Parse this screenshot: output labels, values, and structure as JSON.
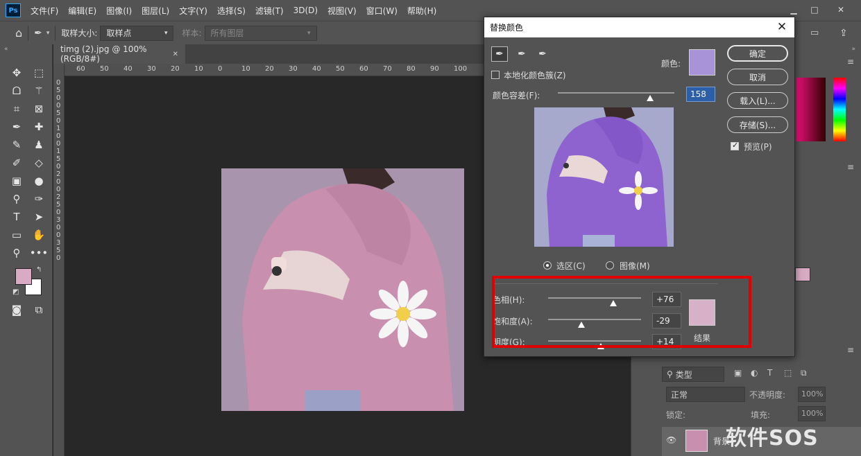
{
  "app": {
    "logo": "Ps",
    "menus": [
      "文件(F)",
      "编辑(E)",
      "图像(I)",
      "图层(L)",
      "文字(Y)",
      "选择(S)",
      "滤镜(T)",
      "3D(D)",
      "视图(V)",
      "窗口(W)",
      "帮助(H)"
    ]
  },
  "options_bar": {
    "sample_size_label": "取样大小:",
    "sample_size_value": "取样点",
    "sample_label": "样本:",
    "sample_value": "所有图层"
  },
  "document": {
    "tab_title": "timg (2).jpg @ 100%(RGB/8#)",
    "h_ruler": [
      "60",
      "50",
      "40",
      "30",
      "20",
      "10",
      "0",
      "10",
      "20",
      "30",
      "40",
      "50",
      "60",
      "70",
      "80",
      "90",
      "100"
    ],
    "v_ruler": [
      "0",
      "5",
      "0",
      "0",
      "5",
      "0",
      "1",
      "0",
      "0",
      "1",
      "5",
      "0",
      "2",
      "0",
      "0",
      "2",
      "5",
      "0",
      "3",
      "0",
      "0",
      "3",
      "5",
      "0"
    ]
  },
  "dialog": {
    "title": "替换颜色",
    "localized_label": "本地化颜色簇(Z)",
    "localized_checked": false,
    "color_label": "颜色:",
    "tolerance_label": "颜色容差(F):",
    "tolerance_value": "158",
    "tolerance_fraction": 0.79,
    "selected_color": "#a893d9",
    "buttons": {
      "ok": "确定",
      "cancel": "取消",
      "load": "载入(L)...",
      "save": "存储(S)..."
    },
    "preview_label": "预览(P)",
    "preview_checked": true,
    "radio_selection": "选区(C)",
    "radio_image": "图像(M)",
    "radio_selected": "selection",
    "hue_label": "色相(H):",
    "hue_value": "+76",
    "hue_fraction": 0.7,
    "saturation_label": "饱和度(A):",
    "saturation_value": "-29",
    "saturation_fraction": 0.355,
    "lightness_label": "明度(G):",
    "lightness_value": "+14",
    "lightness_fraction": 0.57,
    "result_label": "结果",
    "result_color": "#d7b1c8"
  },
  "right_panel": {
    "layers_filter": "类型",
    "blend_mode": "正常",
    "opacity_label": "不透明度:",
    "opacity_value": "100%",
    "lock_label": "锁定:",
    "fill_label": "填充:",
    "fill_value": "100%",
    "layer_name": "背景"
  },
  "colors": {
    "foreground": "#d8aac3",
    "background": "#ffffff",
    "highlight": "#e00000"
  },
  "watermark": "软件SOS"
}
